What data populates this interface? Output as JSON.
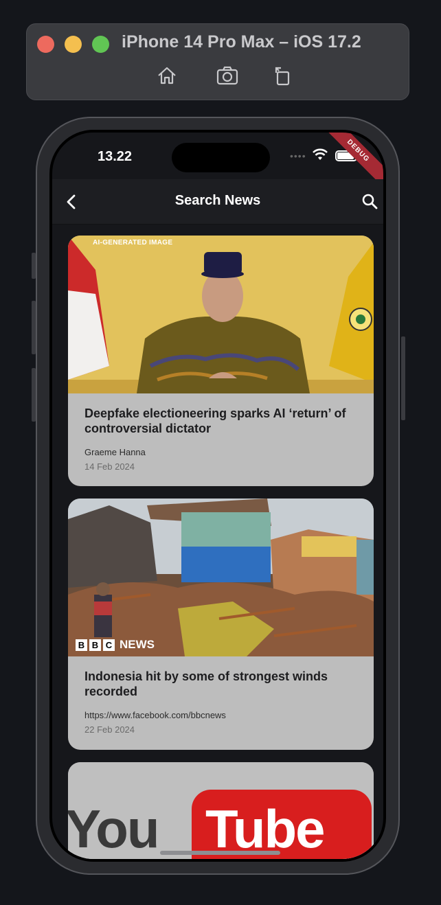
{
  "simulator": {
    "title": "iPhone 14 Pro Max – iOS 17.2",
    "toolbar": [
      "home-icon",
      "screenshot-icon",
      "rotate-icon"
    ]
  },
  "status_bar": {
    "time": "13.22",
    "debug_banner": "DEBUG"
  },
  "app_bar": {
    "title": "Search News"
  },
  "articles": [
    {
      "image_label": "AI-GENERATED IMAGE",
      "title": "Deepfake electioneering sparks AI ‘return’ of controversial dictator",
      "source": "Graeme Hanna",
      "date": "14 Feb 2024"
    },
    {
      "image_brand": [
        "B",
        "B",
        "C",
        "NEWS"
      ],
      "title": "Indonesia hit by some of strongest winds recorded",
      "source": "https://www.facebook.com/bbcnews",
      "date": "22 Feb 2024"
    },
    {
      "image_text": [
        "You",
        "Tube"
      ]
    }
  ],
  "colors": {
    "background": "#14161b",
    "card": "#bdbdbd",
    "debug": "#a52a34",
    "youtube_red": "#d81e1e"
  }
}
